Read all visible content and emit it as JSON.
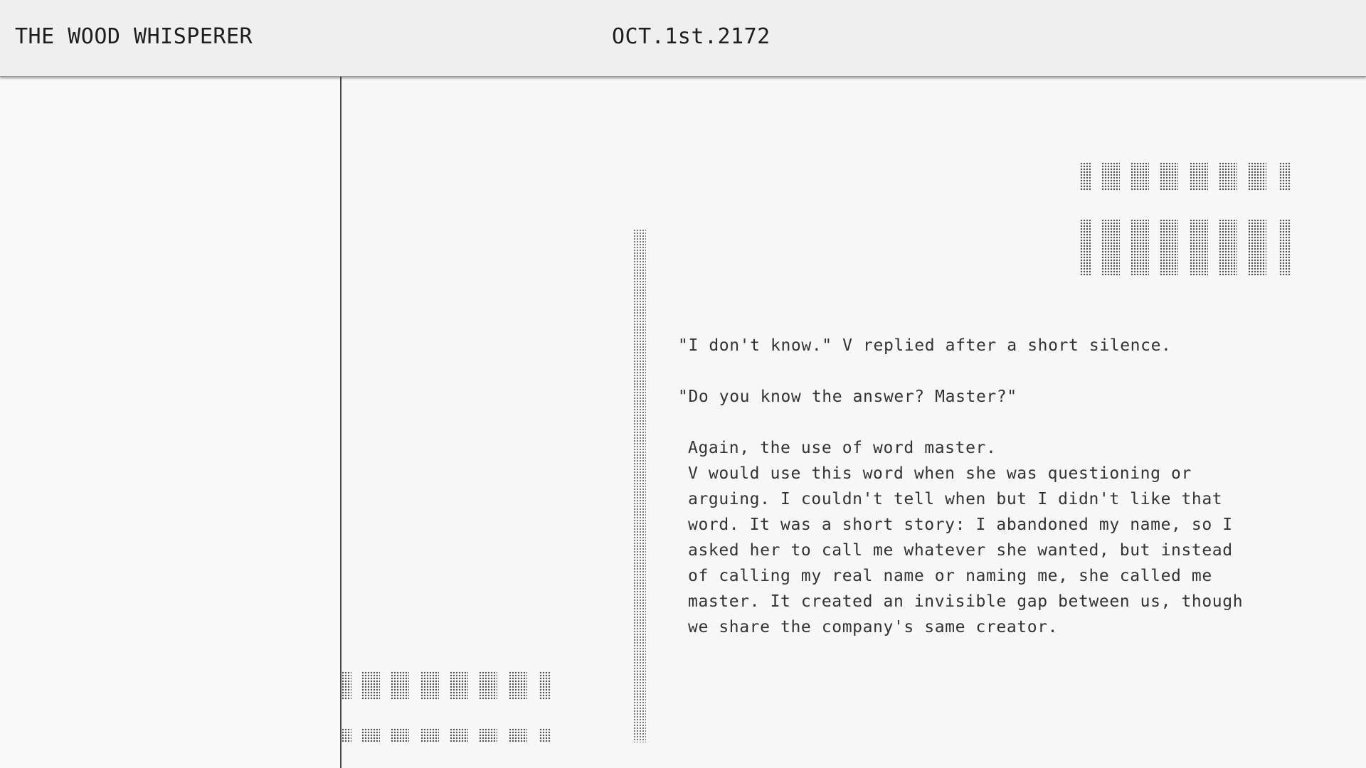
{
  "header": {
    "title": "THE WOOD WHISPERER",
    "date": "OCT.1st.2172"
  },
  "story": {
    "line1": "\"I don't know.\" V replied after a short silence.",
    "line2": "\"Do you know the answer? Master?\"",
    "paragraph": "Again, the use of word master.\nV would use this word when she was questioning or\narguing. I couldn't tell when but I didn't like that\nword. It was a short story: I abandoned my name, so I\nasked her to call me whatever she wanted, but instead\nof calling my real name or naming me, she called me\nmaster. It created an invisible gap between us, though\nwe share the company's same creator."
  },
  "decorations": {
    "pattern": "halftone-dots"
  }
}
